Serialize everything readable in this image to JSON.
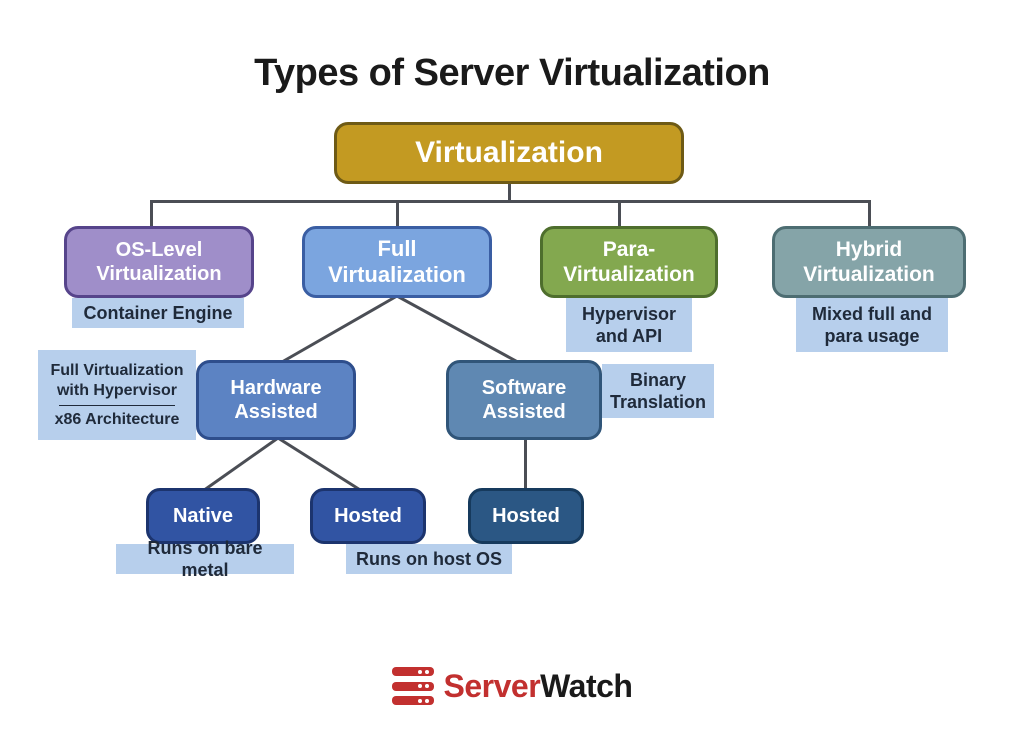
{
  "title": "Types of Server Virtualization",
  "root": {
    "label": "Virtualization"
  },
  "os": {
    "label": "OS-Level Virtualization",
    "note": "Container Engine"
  },
  "full": {
    "label": "Full Virtualization"
  },
  "para": {
    "label": "Para-Virtualization",
    "note": "Hypervisor and API"
  },
  "hybrid": {
    "label": "Hybrid Virtualization",
    "note": "Mixed full and para usage"
  },
  "hw": {
    "label": "Hardware Assisted",
    "note_line1": "Full Virtualization with Hypervisor",
    "note_line2": "x86 Architecture"
  },
  "sw": {
    "label": "Software Assisted",
    "note": "Binary Translation"
  },
  "native": {
    "label": "Native",
    "note": "Runs on bare metal"
  },
  "hosted_hw": {
    "label": "Hosted"
  },
  "hosted_sw": {
    "label": "Hosted",
    "note": "Runs on host OS"
  },
  "brand": {
    "name_a": "Server",
    "name_b": "Watch"
  },
  "colors": {
    "root_fill": "#c39a22",
    "root_border": "#6e5a15",
    "os_fill": "#9f8ec9",
    "os_border": "#56448b",
    "full_fill": "#7ba5df",
    "full_border": "#3a5ea3",
    "para_fill": "#83a84f",
    "para_border": "#4e6e2d",
    "hybrid_fill": "#85a4a8",
    "hybrid_border": "#4d6d72",
    "hw_fill": "#5c83c3",
    "hw_border": "#2e4e8c",
    "sw_fill": "#5f88b2",
    "sw_border": "#305579",
    "native_fill": "#3154a3",
    "native_border": "#1c346e",
    "hosted_hw_fill": "#3154a3",
    "hosted_hw_border": "#1c346e",
    "hosted_sw_fill": "#2b5784",
    "hosted_sw_border": "#163a5d",
    "note_bg": "#b7cfec"
  }
}
